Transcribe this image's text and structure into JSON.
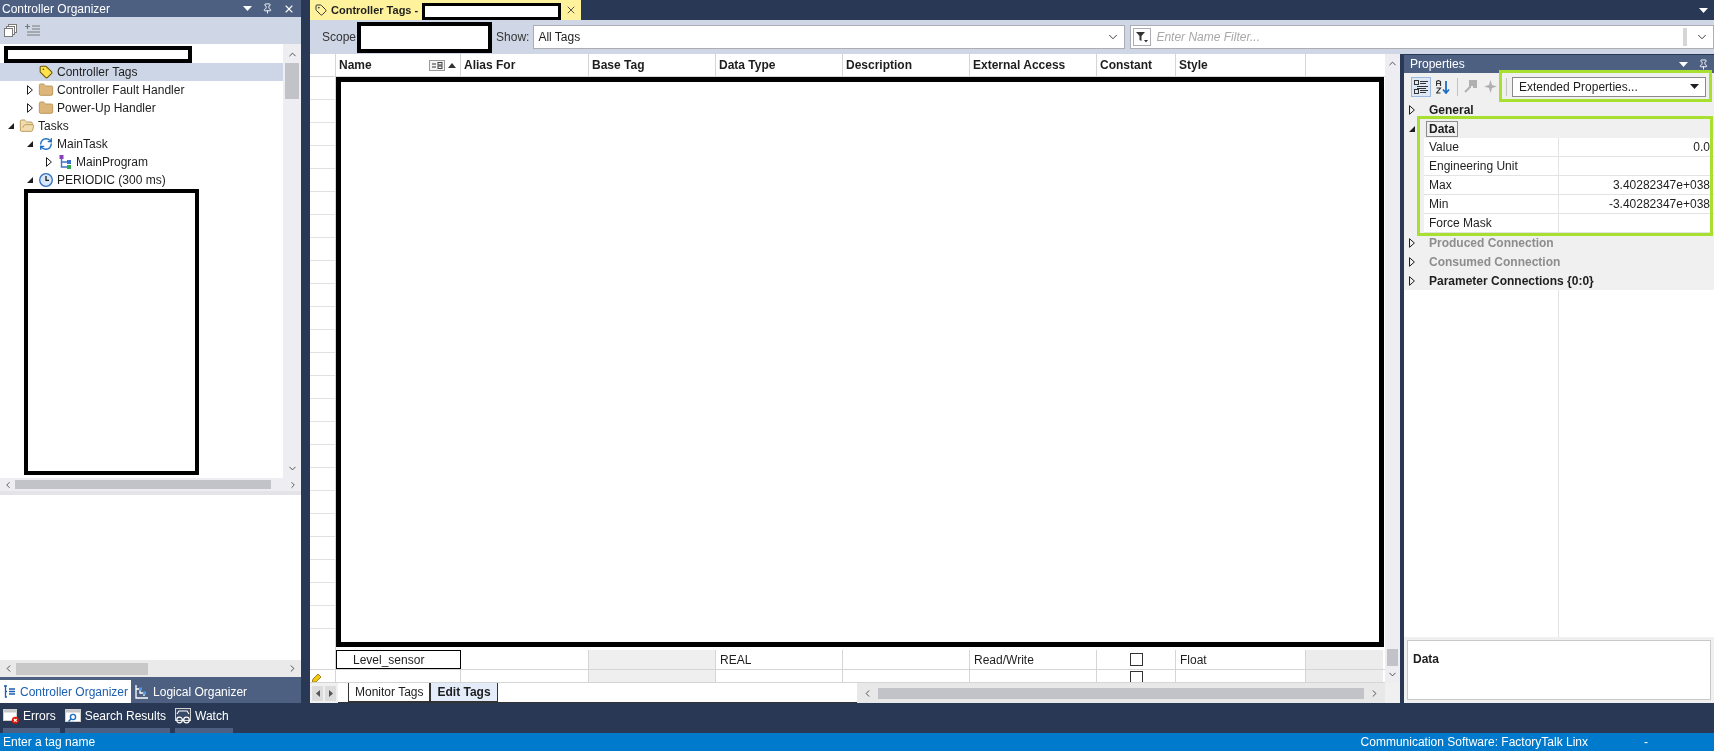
{
  "organizer": {
    "title": "Controller Organizer",
    "tree": [
      {
        "kind": "redacted",
        "children": [
          {
            "kind": "tag",
            "label": "Controller Tags",
            "selected": true
          },
          {
            "kind": "folder",
            "label": "Controller Fault Handler",
            "expanded": false,
            "selected": false
          },
          {
            "kind": "folder",
            "label": "Power-Up Handler",
            "expanded": false,
            "selected": false
          }
        ]
      },
      {
        "kind": "folder",
        "label": "Tasks",
        "expanded": true,
        "selected": false,
        "children": [
          {
            "kind": "task",
            "label": "MainTask",
            "expanded": true,
            "selected": false,
            "children": [
              {
                "kind": "program",
                "label": "MainProgram",
                "expanded": false,
                "selected": false
              }
            ]
          },
          {
            "kind": "periodic",
            "label": "PERIODIC (300 ms)",
            "expanded": true,
            "selected": false,
            "children": [
              {
                "kind": "redacted_block"
              }
            ]
          }
        ]
      }
    ],
    "tabs": [
      {
        "kind": "controller",
        "label": "Controller Organizer",
        "selected": true
      },
      {
        "kind": "logical",
        "label": "Logical Organizer",
        "selected": false
      }
    ]
  },
  "document_tab": {
    "label": "Controller Tags -",
    "selected": true
  },
  "toolbar": {
    "scope_label": "Scope",
    "show_label": "Show:",
    "show_value": "All Tags",
    "filter": {
      "placeholder": "Enter Name Filter..."
    }
  },
  "table": {
    "columns": [
      {
        "label": "Name",
        "sorted": true
      },
      {
        "label": "Alias For",
        "sorted": false
      },
      {
        "label": "Base Tag",
        "sorted": false
      },
      {
        "label": "Data Type",
        "sorted": false
      },
      {
        "label": "Description",
        "sorted": false
      },
      {
        "label": "External Access",
        "sorted": false
      },
      {
        "label": "Constant",
        "sorted": false
      },
      {
        "label": "Style",
        "sorted": false
      }
    ],
    "rows": [
      {
        "kind": "tag",
        "name": "Level_sensor",
        "data_type": "REAL",
        "external_access": "Read/Write",
        "constant": false,
        "style": "Float",
        "selected": true
      },
      {
        "kind": "new",
        "constant": false,
        "selected": false
      }
    ]
  },
  "sheet_tabs": [
    {
      "label": "Monitor Tags",
      "selected": false
    },
    {
      "label": "Edit Tags",
      "selected": true
    }
  ],
  "properties": {
    "title": "Properties",
    "buttons": [
      {
        "kind": "categorized",
        "selected": true,
        "disabled": false
      },
      {
        "kind": "alphabetical",
        "selected": false,
        "disabled": false
      },
      {
        "kind": "property_pages",
        "selected": false,
        "disabled": true
      },
      {
        "kind": "events",
        "selected": false,
        "disabled": true
      }
    ],
    "view": {
      "value": "Extended Properties...",
      "highlighted": true
    },
    "categories": [
      {
        "label": "General",
        "expanded": false,
        "disabled": false,
        "selected": false
      },
      {
        "label": "Data",
        "expanded": true,
        "disabled": false,
        "selected": true,
        "highlighted": true,
        "rows": [
          {
            "name": "Value",
            "value": "0.0"
          },
          {
            "name": "Engineering Unit"
          },
          {
            "name": "Max",
            "value": "3.40282347e+038"
          },
          {
            "name": "Min",
            "value": "-3.40282347e+038"
          },
          {
            "name": "Force Mask"
          }
        ]
      },
      {
        "label": "Produced Connection",
        "expanded": false,
        "disabled": true,
        "selected": false
      },
      {
        "label": "Consumed Connection",
        "expanded": false,
        "disabled": true,
        "selected": false
      },
      {
        "label": "Parameter Connections {0:0}",
        "expanded": false,
        "disabled": false,
        "selected": false
      }
    ],
    "description": "Data"
  },
  "output_tabs": [
    {
      "kind": "errors",
      "label": "Errors"
    },
    {
      "kind": "search",
      "label": "Search Results"
    },
    {
      "kind": "watch",
      "label": "Watch"
    }
  ],
  "status_bar": {
    "message": "Enter a tag name",
    "connection": "Communication Software: FactoryTalk Linx",
    "extra": "-"
  }
}
